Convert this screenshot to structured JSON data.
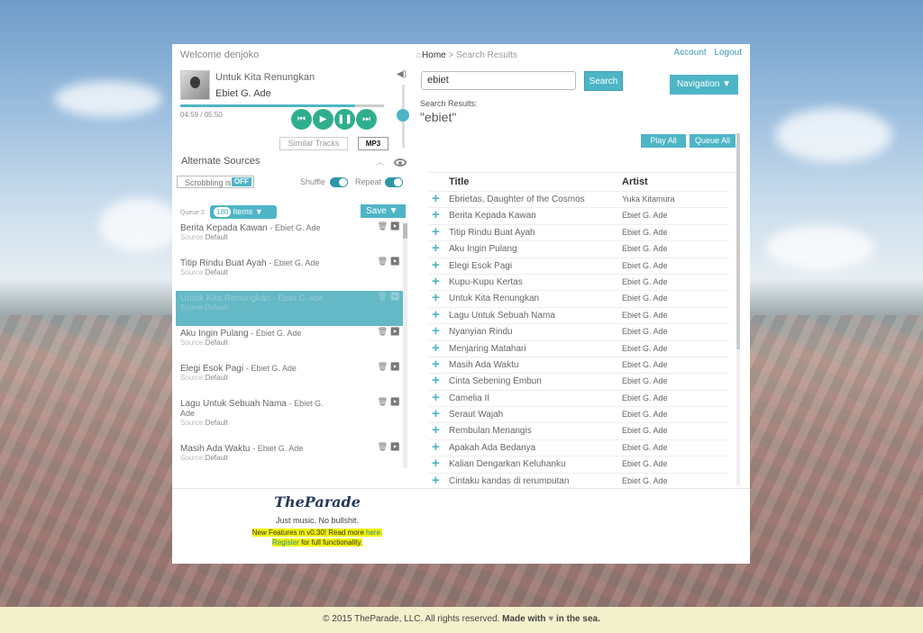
{
  "header": {
    "welcome": "Welcome denjoko",
    "breadcrumb_home": "Home",
    "breadcrumb_rest": " > Search Results",
    "account": "Account",
    "logout": "Logout"
  },
  "player": {
    "title": "Untuk Kita Renungkan",
    "artist": "Ebiet G. Ade",
    "time": "04:59 / 05:50",
    "progress": 0.86,
    "similar_tracks": "Similar Tracks",
    "format_badge": "MP3"
  },
  "sources": {
    "label": "Alternate Sources",
    "scrobbling_label": "Scrobbling is",
    "scrobbling_state": "OFF",
    "shuffle": "Shuffle",
    "repeat": "Repeat"
  },
  "queue": {
    "label": "Queue 2",
    "count": "180",
    "count_suffix": "Items",
    "save": "Save",
    "source_label": "Source:",
    "items": [
      {
        "title": "Berita Kepada Kawan",
        "artist": "- Ebiet G. Ade",
        "source": "Default"
      },
      {
        "title": "Titip Rindu Buat Ayah",
        "artist": "- Ebiet G. Ade",
        "source": "Default"
      },
      {
        "title": "Untuk Kita Renungkan",
        "artist": "- Ebiet G. Ade",
        "source": "Default"
      },
      {
        "title": "Aku Ingin Pulang",
        "artist": "- Ebiet G. Ade",
        "source": "Default"
      },
      {
        "title": "Elegi Esok Pagi",
        "artist": "- Ebiet G. Ade",
        "source": "Default"
      },
      {
        "title": "Lagu Untuk Sebuah Nama",
        "artist": "- Ebiet G. Ade",
        "source": "Default"
      },
      {
        "title": "Masih Ada Waktu",
        "artist": "- Ebiet G. Ade",
        "source": "Default"
      }
    ]
  },
  "search": {
    "value": "ebiet",
    "button": "Search",
    "navigation": "Navigation",
    "results_label": "Search Results:",
    "query_display": "\"ebiet\"",
    "play_all": "Play All",
    "queue_all": "Queue All",
    "col_title": "Title",
    "col_artist": "Artist",
    "rows": [
      {
        "title": "Ebrietas, Daughter of the Cosmos",
        "artist": "Yuka Kitamura"
      },
      {
        "title": "Berita Kepada Kawan",
        "artist": "Ebiet G. Ade"
      },
      {
        "title": "Titip Rindu Buat Ayah",
        "artist": "Ebiet G. Ade"
      },
      {
        "title": "Aku Ingin Pulang",
        "artist": "Ebiet G. Ade"
      },
      {
        "title": "Elegi Esok Pagi",
        "artist": "Ebiet G. Ade"
      },
      {
        "title": "Kupu-Kupu Kertas",
        "artist": "Ebiet G. Ade"
      },
      {
        "title": "Untuk Kita Renungkan",
        "artist": "Ebiet G. Ade"
      },
      {
        "title": "Lagu Untuk Sebuah Nama",
        "artist": "Ebiet G. Ade"
      },
      {
        "title": "Nyanyian Rindu",
        "artist": "Ebiet G. Ade"
      },
      {
        "title": "Menjaring Matahari",
        "artist": "Ebiet G. Ade"
      },
      {
        "title": "Masih Ada Waktu",
        "artist": "Ebiet G. Ade"
      },
      {
        "title": "Cinta Sebening Embun",
        "artist": "Ebiet G. Ade"
      },
      {
        "title": "Camelia II",
        "artist": "Ebiet G. Ade"
      },
      {
        "title": "Seraut Wajah",
        "artist": "Ebiet G. Ade"
      },
      {
        "title": "Rembulan Menangis",
        "artist": "Ebiet G. Ade"
      },
      {
        "title": "Apakah Ada Bedanya",
        "artist": "Ebiet G. Ade"
      },
      {
        "title": "Kalian Dengarkan Keluhanku",
        "artist": "Ebiet G. Ade"
      },
      {
        "title": "Cintaku kandas di rerumputan",
        "artist": "Ebiet G. Ade"
      }
    ]
  },
  "promo": {
    "logo": "TheParade",
    "tagline": "Just music. No bullshit.",
    "news_prefix": "New Features in v0.30! Read more ",
    "news_link": "here.",
    "register_link": "Register",
    "register_suffix": " for full functionality."
  },
  "footer": {
    "copyright": "© 2015 TheParade, LLC. All rights reserved.",
    "made_prefix": "Made with",
    "made_suffix": "in the sea."
  },
  "colors": {
    "accent": "#4eb5c6",
    "play_controls": "#2fae8e",
    "selected_row": "#65b8c5",
    "footer_bg": "#f3f0cc"
  },
  "icons": {
    "home": "home-icon",
    "volume": "volume-icon",
    "previous": "previous-icon",
    "play": "play-icon",
    "pause": "pause-icon",
    "next": "next-icon",
    "eye": "eye-icon",
    "trash": "trash-icon",
    "add": "plus-icon",
    "heart": "heart-icon"
  }
}
